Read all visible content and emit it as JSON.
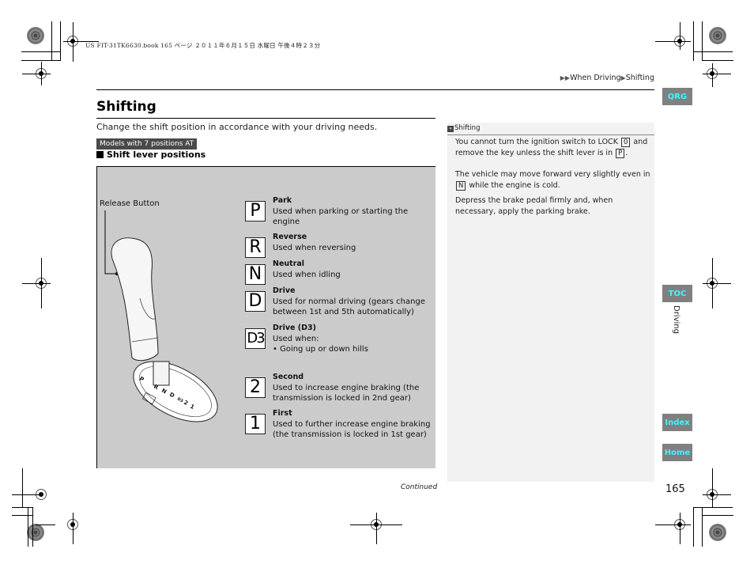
{
  "print_header": "US FIT-31TK6630.book  165 ページ  ２０１１年６月１５日  水曜日  午後４時２３分",
  "breadcrumb": {
    "items": [
      "When Driving",
      "Shifting"
    ],
    "separator_icon": "triangle-right-icon"
  },
  "side_tabs": {
    "qrg": "QRG",
    "toc": "TOC",
    "index": "Index",
    "home": "Home",
    "section": "Driving",
    "accent_color": "#3ff5ff",
    "tab_bg": "#808080"
  },
  "page": {
    "title": "Shifting",
    "intro": "Change the shift position in accordance with your driving needs.",
    "model_badge": "Models with 7 positions AT",
    "subheading": "Shift lever positions",
    "figure": {
      "release_button_label": "Release Button",
      "gate_labels": [
        "P",
        "R",
        "N",
        "D",
        "D3",
        "2",
        "1"
      ]
    },
    "positions": [
      {
        "symbol": "P",
        "name": "Park",
        "desc": "Used when parking or starting the engine"
      },
      {
        "symbol": "R",
        "name": "Reverse",
        "desc": "Used when reversing"
      },
      {
        "symbol": "N",
        "name": "Neutral",
        "desc": "Used when idling"
      },
      {
        "symbol": "D",
        "name": "Drive",
        "desc": "Used for normal driving (gears change between 1st and 5th automatically)"
      },
      {
        "symbol": "D3",
        "name": "Drive (D3)",
        "desc": "Used when:",
        "bullet": "Going up or down hills"
      },
      {
        "symbol": "2",
        "name": "Second",
        "desc": "Used to increase engine braking (the transmission is locked in 2nd gear)"
      },
      {
        "symbol": "1",
        "name": "First",
        "desc": "Used to further increase engine braking (the transmission is locked in 1st gear)"
      }
    ],
    "continued": "Continued",
    "page_number": "165"
  },
  "note": {
    "heading": "Shifting",
    "p1_a": "You cannot turn the ignition switch to LOCK",
    "p1_key1": "0",
    "p1_b": "and remove the key unless the shift lever is in",
    "p1_key2": "P",
    "p1_c": ".",
    "p2_key": "N",
    "p2_a": "The vehicle may move forward very slightly even in",
    "p2_b": "while the engine is cold.",
    "p3": "Depress the brake pedal firmly and, when necessary, apply the parking brake."
  }
}
